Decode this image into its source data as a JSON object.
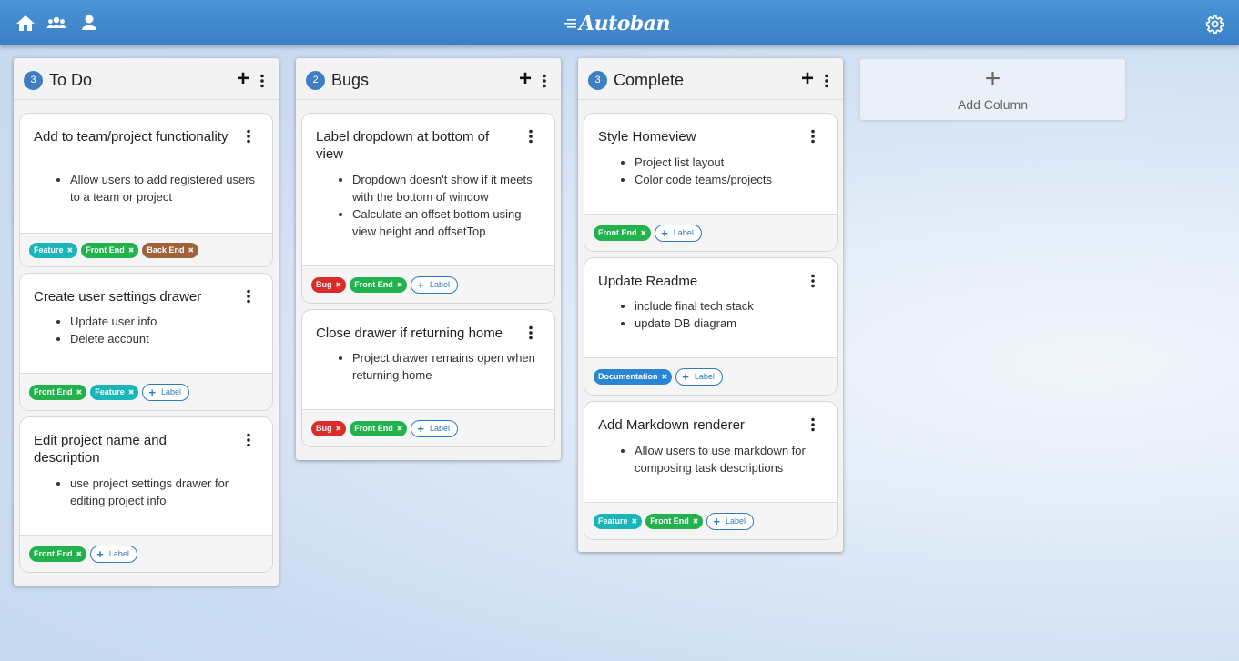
{
  "header": {
    "brand": "Autoban",
    "icons": [
      "home-icon",
      "team-icon",
      "user-icon",
      "gear-icon"
    ],
    "bar_color": "#3f86cc"
  },
  "columns": [
    {
      "count": "3",
      "title": "To Do",
      "cards": [
        {
          "title": "Add to team/project functionality",
          "items": [
            "Allow users to add registered users to a team or project"
          ],
          "tags": [
            {
              "label": "Feature",
              "color": "#1ab5b8"
            },
            {
              "label": "Front End",
              "color": "#22b14c"
            },
            {
              "label": "Back End",
              "color": "#a0613d"
            }
          ],
          "add_label": null
        },
        {
          "title": "Create user settings drawer",
          "items": [
            "Update user info",
            "Delete account"
          ],
          "tags": [
            {
              "label": "Front End",
              "color": "#22b14c"
            },
            {
              "label": "Feature",
              "color": "#1ab5b8"
            }
          ],
          "add_label": "Label"
        },
        {
          "title": "Edit project name and description",
          "items": [
            "use project settings drawer for editing project info"
          ],
          "tags": [
            {
              "label": "Front End",
              "color": "#22b14c"
            }
          ],
          "add_label": "Label"
        }
      ]
    },
    {
      "count": "2",
      "title": "Bugs",
      "cards": [
        {
          "title": "Label dropdown at bottom of view",
          "items": [
            "Dropdown doesn't show if it meets with the bottom of window",
            "Calculate an offset bottom using view height and offsetTop"
          ],
          "tags": [
            {
              "label": "Bug",
              "color": "#dc2b2b"
            },
            {
              "label": "Front End",
              "color": "#22b14c"
            }
          ],
          "add_label": "Label"
        },
        {
          "title": "Close drawer if returning home",
          "items": [
            "Project drawer remains open when returning home"
          ],
          "tags": [
            {
              "label": "Bug",
              "color": "#dc2b2b"
            },
            {
              "label": "Front End",
              "color": "#22b14c"
            }
          ],
          "add_label": "Label"
        }
      ]
    },
    {
      "count": "3",
      "title": "Complete",
      "cards": [
        {
          "title": "Style Homeview",
          "items": [
            "Project list layout",
            "Color code teams/projects"
          ],
          "tags": [
            {
              "label": "Front End",
              "color": "#22b14c"
            }
          ],
          "add_label": "Label"
        },
        {
          "title": "Update Readme",
          "items": [
            "include final tech stack",
            "update DB diagram"
          ],
          "tags": [
            {
              "label": "Documentation",
              "color": "#2a86d4"
            }
          ],
          "add_label": "Label"
        },
        {
          "title": "Add Markdown renderer",
          "items": [
            "Allow users to use markdown for composing task descriptions"
          ],
          "tags": [
            {
              "label": "Feature",
              "color": "#1ab5b8"
            },
            {
              "label": "Front End",
              "color": "#22b14c"
            }
          ],
          "add_label": "Label"
        }
      ]
    }
  ],
  "add_column": {
    "plus": "+",
    "label": "Add Column"
  }
}
